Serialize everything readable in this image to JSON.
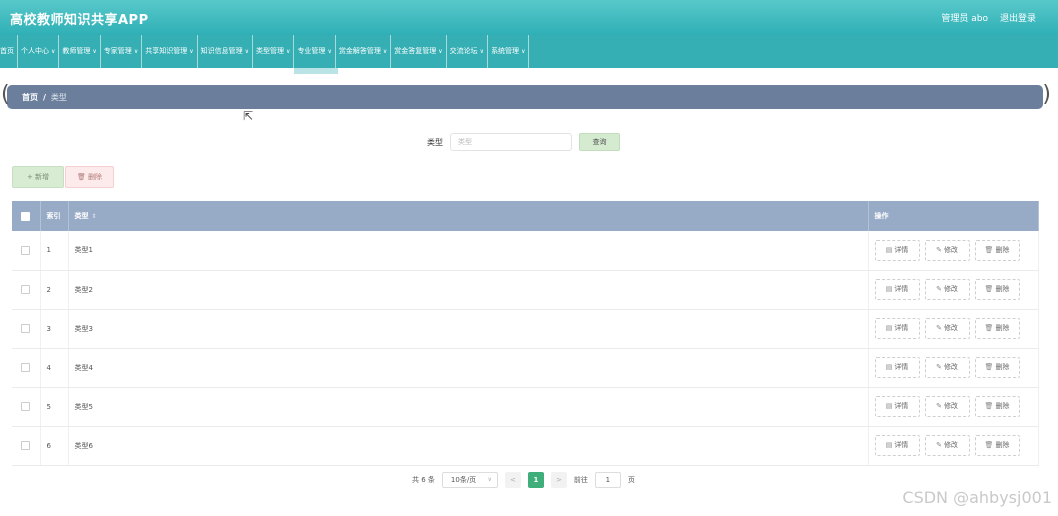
{
  "header": {
    "app_title": "高校教师知识共享APP",
    "user_label": "管理员 abo",
    "logout_label": "退出登录"
  },
  "nav": {
    "items": [
      {
        "label": "首页",
        "chev": ""
      },
      {
        "label": "个人中心",
        "chev": "∨"
      },
      {
        "label": "教师管理",
        "chev": "∨"
      },
      {
        "label": "专家管理",
        "chev": "∨"
      },
      {
        "label": "共享知识管理",
        "chev": "∨"
      },
      {
        "label": "知识信息管理",
        "chev": "∨"
      },
      {
        "label": "类型管理",
        "chev": "∨"
      },
      {
        "label": "专业管理",
        "chev": "∨"
      },
      {
        "label": "赏金解答管理",
        "chev": "∨"
      },
      {
        "label": "赏金答复管理",
        "chev": "∨"
      },
      {
        "label": "交流论坛",
        "chev": "∨"
      },
      {
        "label": "系统管理",
        "chev": "∨"
      }
    ]
  },
  "breadcrumb": {
    "home": "首页",
    "sep": "/",
    "current": "类型"
  },
  "search": {
    "label": "类型",
    "placeholder": "类型",
    "button": "查询"
  },
  "toolbar": {
    "add_label": "+ 新增",
    "delete_label": "🗑 删除"
  },
  "table": {
    "headers": {
      "index": "索引",
      "type": "类型",
      "ops": "操作"
    },
    "sort_icon": "⇕",
    "rows": [
      {
        "index": "1",
        "type": "类型1"
      },
      {
        "index": "2",
        "type": "类型2"
      },
      {
        "index": "3",
        "type": "类型3"
      },
      {
        "index": "4",
        "type": "类型4"
      },
      {
        "index": "5",
        "type": "类型5"
      },
      {
        "index": "6",
        "type": "类型6"
      }
    ],
    "ops": {
      "detail": "详情",
      "edit": "修改",
      "delete": "删除"
    }
  },
  "pager": {
    "total": "共 6 条",
    "page_size": "10条/页",
    "prev": "<",
    "current": "1",
    "next": ">",
    "jump_prefix": "前往",
    "jump_value": "1",
    "jump_suffix": "页"
  },
  "watermark": "CSDN @ahbysj001",
  "colors": {
    "header": "#2fb0b6",
    "breadcrumb_bg": "#6b7f9d",
    "table_header": "#97aac6",
    "pager_active": "#3fae7a"
  }
}
